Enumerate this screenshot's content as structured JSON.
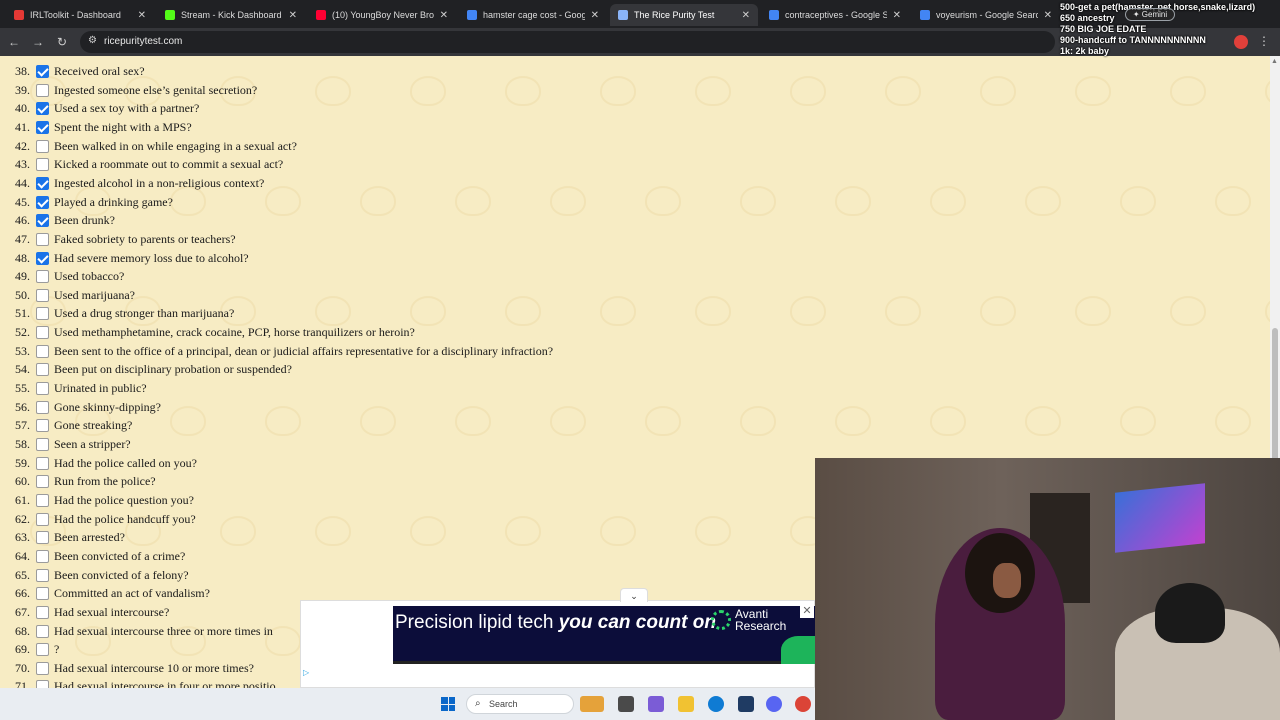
{
  "browser": {
    "tabs": [
      {
        "label": "IRLToolkit - Dashboard",
        "favicon_color": "#e53935",
        "active": false
      },
      {
        "label": "Stream - Kick Dashboard",
        "favicon_color": "#53fc18",
        "active": false
      },
      {
        "label": "(10) YoungBoy Never Broke A",
        "favicon_color": "#ff0033",
        "active": false
      },
      {
        "label": "hamster cage cost - Google S",
        "favicon_color": "#4285f4",
        "active": false
      },
      {
        "label": "The Rice Purity Test",
        "favicon_color": "#8ab4f8",
        "active": true
      },
      {
        "label": "contraceptives - Google Sear",
        "favicon_color": "#4285f4",
        "active": false
      },
      {
        "label": "voyeurism - Google Search",
        "favicon_color": "#4285f4",
        "active": false
      }
    ],
    "url": "ricepuritytest.com",
    "gemini_label": "✦ Gemini"
  },
  "stream_overlay": {
    "lines": [
      "500-get a pet(hamster, pet horse,snake,lizard)",
      "650 ancestry",
      "750 BIG JOE EDATE",
      "900-handcuff to TANNNNNNNNNN",
      "1k: 2k baby"
    ]
  },
  "questions": [
    {
      "num": "38.",
      "text": "Received oral sex?",
      "checked": true
    },
    {
      "num": "39.",
      "text": "Ingested someone else’s genital secretion?",
      "checked": false
    },
    {
      "num": "40.",
      "text": "Used a sex toy with a partner?",
      "checked": true
    },
    {
      "num": "41.",
      "text": "Spent the night with a MPS?",
      "checked": true
    },
    {
      "num": "42.",
      "text": "Been walked in on while engaging in a sexual act?",
      "checked": false
    },
    {
      "num": "43.",
      "text": "Kicked a roommate out to commit a sexual act?",
      "checked": false
    },
    {
      "num": "44.",
      "text": "Ingested alcohol in a non-religious context?",
      "checked": true
    },
    {
      "num": "45.",
      "text": "Played a drinking game?",
      "checked": true
    },
    {
      "num": "46.",
      "text": "Been drunk?",
      "checked": true
    },
    {
      "num": "47.",
      "text": "Faked sobriety to parents or teachers?",
      "checked": false
    },
    {
      "num": "48.",
      "text": "Had severe memory loss due to alcohol?",
      "checked": true
    },
    {
      "num": "49.",
      "text": "Used tobacco?",
      "checked": false
    },
    {
      "num": "50.",
      "text": "Used marijuana?",
      "checked": false
    },
    {
      "num": "51.",
      "text": "Used a drug stronger than marijuana?",
      "checked": false
    },
    {
      "num": "52.",
      "text": "Used methamphetamine, crack cocaine, PCP, horse tranquilizers or heroin?",
      "checked": false
    },
    {
      "num": "53.",
      "text": "Been sent to the office of a principal, dean or judicial affairs representative for a disciplinary infraction?",
      "checked": false
    },
    {
      "num": "54.",
      "text": "Been put on disciplinary probation or suspended?",
      "checked": false
    },
    {
      "num": "55.",
      "text": "Urinated in public?",
      "checked": false
    },
    {
      "num": "56.",
      "text": "Gone skinny-dipping?",
      "checked": false
    },
    {
      "num": "57.",
      "text": "Gone streaking?",
      "checked": false
    },
    {
      "num": "58.",
      "text": "Seen a stripper?",
      "checked": false
    },
    {
      "num": "59.",
      "text": "Had the police called on you?",
      "checked": false
    },
    {
      "num": "60.",
      "text": "Run from the police?",
      "checked": false
    },
    {
      "num": "61.",
      "text": "Had the police question you?",
      "checked": false
    },
    {
      "num": "62.",
      "text": "Had the police handcuff you?",
      "checked": false
    },
    {
      "num": "63.",
      "text": "Been arrested?",
      "checked": false
    },
    {
      "num": "64.",
      "text": "Been convicted of a crime?",
      "checked": false
    },
    {
      "num": "65.",
      "text": "Been convicted of a felony?",
      "checked": false
    },
    {
      "num": "66.",
      "text": "Committed an act of vandalism?",
      "checked": false
    },
    {
      "num": "67.",
      "text": "Had sexual intercourse?",
      "checked": false
    },
    {
      "num": "68.",
      "text": "Had sexual intercourse three or more times in",
      "checked": false
    },
    {
      "num": "69.",
      "text": "?",
      "checked": false
    },
    {
      "num": "70.",
      "text": "Had sexual intercourse 10 or more times?",
      "checked": false
    },
    {
      "num": "71.",
      "text": "Had sexual intercourse in four or more positio",
      "checked": false
    }
  ],
  "ad": {
    "text_plain": "Precision lipid tech ",
    "text_emph": "you can count on",
    "brand_line1": "Avanti",
    "brand_line2": "Research"
  },
  "taskbar": {
    "search_label": "Search"
  }
}
